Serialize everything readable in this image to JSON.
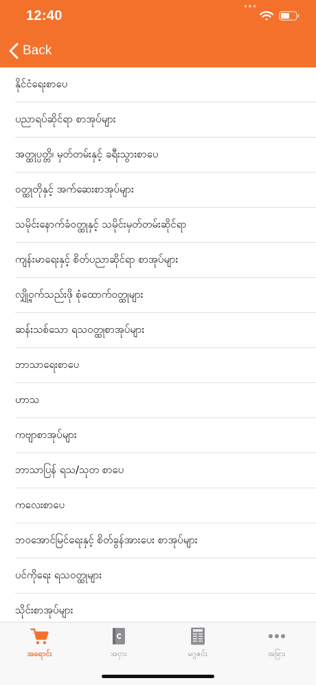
{
  "status_bar": {
    "time": "12:40"
  },
  "nav": {
    "back_label": "Back"
  },
  "colors": {
    "accent": "#f4712c",
    "tab_inactive": "#8e8e93"
  },
  "categories": [
    "နိုင်ငံရေးစာပေ",
    "ပညာရပ်ဆိုင်ရာ စာအုပ်များ",
    "အတ္ထုပ္ပတ္တိ၊ မှတ်တမ်းနှင့် ခရီးသွားစာပေ",
    "ဝတ္ထုတိုနှင့် အက်ဆေးစာအုပ်များ",
    "သမိုင်းနောက်ခံဝတ္ထုနှင့် သမိုင်းမှတ်တမ်းဆိုင်ရာ",
    "ကျန်းမာရေးနှင့် စိတ်ပညာဆိုင်ရာ စာအုပ်များ",
    "လျှို့ဝှက်သည်းဖို စုံထောက်ဝတ္ထုများ",
    "ဆန်းသစ်သော ရသဝတ္ထုစာအုပ်များ",
    "ဘာသာရေးစာပေ",
    "ဟာသ",
    "ကဗျာစာအုပ်များ",
    "ဘာသာပြန် ရသ/သုတ စာပေ",
    "ကလေးစာပေ",
    "ဘဝအောင်မြင်ရေးနှင့် စိတ်ခွန်အားပေး စာအုပ်များ",
    "ပင်ကိုရေး ရသဝတ္ထုများ",
    "သိုင်းစာအုပ်များ"
  ],
  "tabs": [
    {
      "label": "အရောင်း",
      "icon": "cart-icon"
    },
    {
      "label": "အငှား",
      "icon": "book-icon"
    },
    {
      "label": "မဂ္ဂဇင်း",
      "icon": "magazine-icon"
    },
    {
      "label": "အခြား",
      "icon": "more-icon"
    }
  ]
}
